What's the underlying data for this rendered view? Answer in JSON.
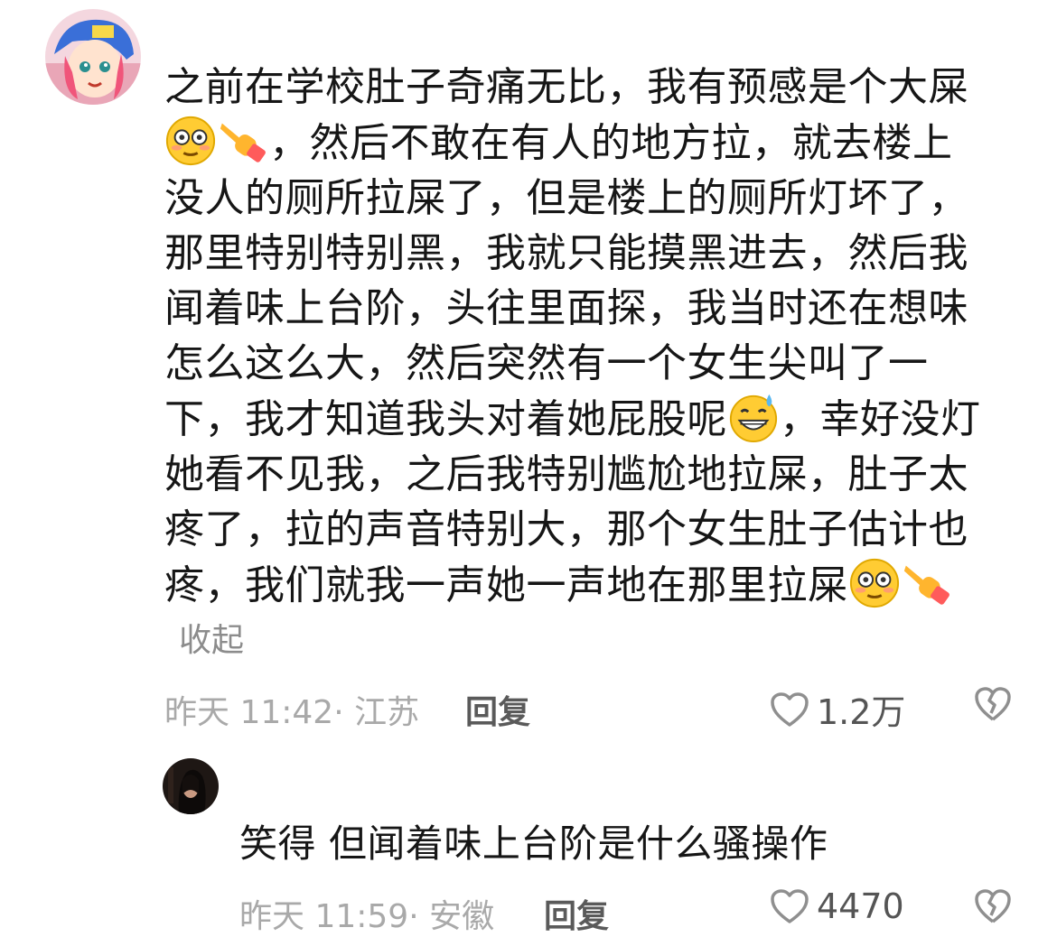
{
  "main_comment": {
    "lines": [
      [
        "之前在学校肚子奇痛无比，我有预感是个大屎"
      ],
      [
        "",
        "，然后不敢在有人的地方拉，就去楼上"
      ],
      [
        "没人的厕所拉屎了，但是楼上的厕所灯坏了，"
      ],
      [
        "那里特别特别黑，我就只能摸黑进去，然后我"
      ],
      [
        "闻着味上台阶，头往里面探，我当时还在想味"
      ],
      [
        "怎么这么大，然后突然有一个女生尖叫了一"
      ],
      [
        "下，我才知道我头对着她屁股呢",
        "，幸好没灯"
      ],
      [
        "她看不见我，之后我特别尴尬地拉屎，肚子太"
      ],
      [
        "疼了，拉的声音特别大，那个女生肚子估计也"
      ],
      [
        "疼，我们就我一声她一声地在那里拉屎"
      ]
    ],
    "emojis": [
      "flushed-face",
      "pointing-hand",
      "grinning-sweat-face"
    ],
    "collapse_label": "收起",
    "meta": "昨天 11:42· 江苏",
    "reply_label": "回复",
    "like_count": "1.2万"
  },
  "reply_comment": {
    "text": "笑得 但闻着味上台阶是什么骚操作",
    "meta": "昨天 11:59· 安徽",
    "reply_label": "回复",
    "like_count": "4470"
  },
  "colors": {
    "text": "#161616",
    "meta": "#a9a9a9",
    "emoji_face": "#ffcc33",
    "hand": "#ffb52e",
    "sleeve": "#ff5b5b"
  }
}
